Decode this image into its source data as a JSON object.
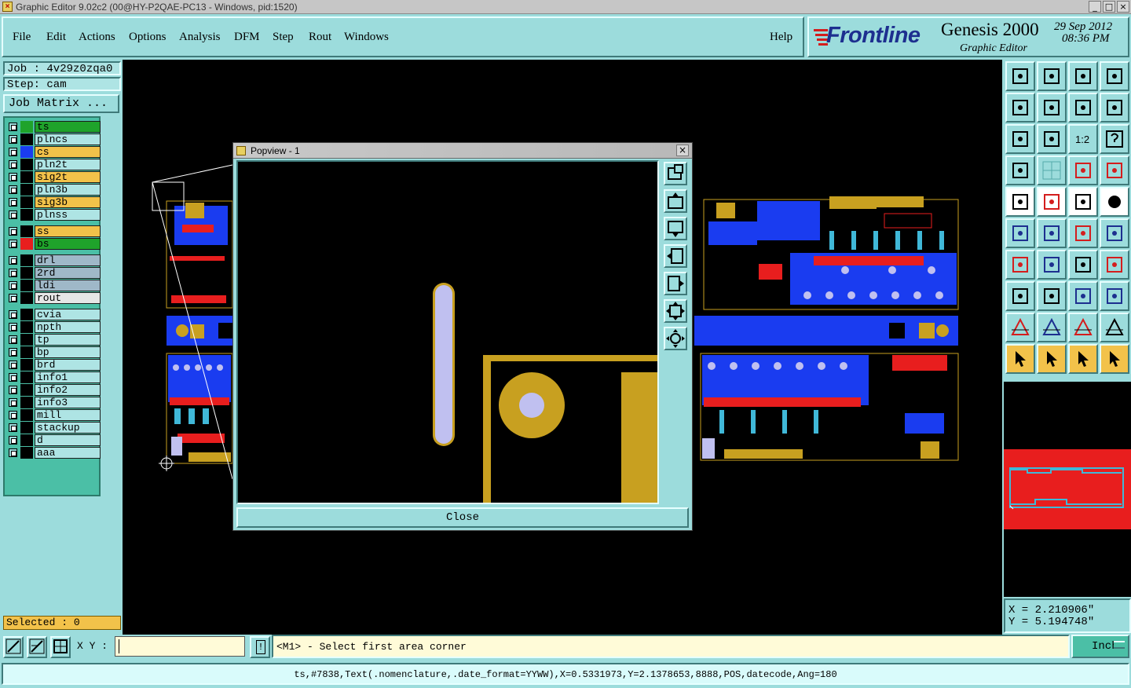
{
  "window": {
    "title": "Graphic Editor 9.02c2 (00@HY-P2QAE-PC13 - Windows, pid:1520)",
    "min_glyph": "_",
    "max_glyph": "□",
    "close_glyph": "×"
  },
  "menu": {
    "items": [
      "File",
      "Edit",
      "Actions",
      "Options",
      "Analysis",
      "DFM",
      "Step",
      "Rout",
      "Windows"
    ],
    "help": "Help"
  },
  "logo": {
    "brand": "Frontline",
    "product": "Genesis 2000",
    "subtitle": "Graphic Editor",
    "date": "29 Sep 2012",
    "time": "08:36 PM"
  },
  "job": {
    "job_label": "Job : 4v29z0zqa0",
    "step_label": "Step: cam",
    "matrix_button": "Job Matrix ..."
  },
  "layers": [
    {
      "name": "ts",
      "swatch": "#1fa32b",
      "bg": "#1fa32b"
    },
    {
      "name": "plncs",
      "swatch": "#000000",
      "bg": "#aee4e4"
    },
    {
      "name": "cs",
      "swatch": "#1a3cf0",
      "bg": "#f2c24a"
    },
    {
      "name": "pln2t",
      "swatch": "#000000",
      "bg": "#aee4e4"
    },
    {
      "name": "sig2t",
      "swatch": "#000000",
      "bg": "#f2c24a"
    },
    {
      "name": "pln3b",
      "swatch": "#000000",
      "bg": "#aee4e4"
    },
    {
      "name": "sig3b",
      "swatch": "#000000",
      "bg": "#f2c24a"
    },
    {
      "name": "plnss",
      "swatch": "#000000",
      "bg": "#aee4e4"
    },
    {
      "name": "ss",
      "swatch": "#000000",
      "bg": "#f2c24a"
    },
    {
      "name": "bs",
      "swatch": "#e81e1e",
      "bg": "#1fa32b"
    },
    {
      "name": "drl",
      "swatch": "#000000",
      "bg": "#9fb8c8"
    },
    {
      "name": "2rd",
      "swatch": "#000000",
      "bg": "#9fb8c8"
    },
    {
      "name": "ldi",
      "swatch": "#000000",
      "bg": "#9fb8c8"
    },
    {
      "name": "rout",
      "swatch": "#000000",
      "bg": "#e6e6e6"
    },
    {
      "name": "cvia",
      "swatch": "#000000",
      "bg": "#aee4e4"
    },
    {
      "name": "npth",
      "swatch": "#000000",
      "bg": "#aee4e4"
    },
    {
      "name": "tp",
      "swatch": "#000000",
      "bg": "#aee4e4"
    },
    {
      "name": "bp",
      "swatch": "#000000",
      "bg": "#aee4e4"
    },
    {
      "name": "brd",
      "swatch": "#000000",
      "bg": "#aee4e4"
    },
    {
      "name": "info1",
      "swatch": "#000000",
      "bg": "#aee4e4"
    },
    {
      "name": "info2",
      "swatch": "#000000",
      "bg": "#aee4e4"
    },
    {
      "name": "info3",
      "swatch": "#000000",
      "bg": "#aee4e4"
    },
    {
      "name": "mill",
      "swatch": "#000000",
      "bg": "#aee4e4"
    },
    {
      "name": "stackup",
      "swatch": "#000000",
      "bg": "#aee4e4"
    },
    {
      "name": "d",
      "swatch": "#000000",
      "bg": "#aee4e4"
    },
    {
      "name": "aaa",
      "swatch": "#000000",
      "bg": "#aee4e4"
    }
  ],
  "selection": {
    "text": "Selected : 0"
  },
  "popview": {
    "title": "Popview - 1",
    "close_glyph": "×",
    "close_button": "Close"
  },
  "coords": {
    "x": "X = 2.210906\"",
    "y": "Y = 5.194748\""
  },
  "input": {
    "xy_label": "X Y :",
    "prompt": "<M1> - Select first area corner",
    "units": "Inch",
    "excl_glyph": "!"
  },
  "status": {
    "line": "ts,#7838,Text(.nomenclature,.date_format=YYWW),X=0.5331973,Y=2.1378653,8888,POS,datecode,Ang=180"
  },
  "toolbar_tools": [
    "copy-to-layer-icon",
    "move-to-layer-icon",
    "home-icon",
    "split-view-icon",
    "pan-left-icon",
    "pan-right-icon",
    "undo-view-icon",
    "flip-view-icon",
    "zoom-fit-icon",
    "zoom-center-icon",
    "one-to-one-icon",
    "help-icon",
    "graphic-controls-icon",
    "grid-icon",
    "snap-red-icon",
    "snap-red-alt-icon",
    "add-feature-icon",
    "ruler-red-icon",
    "measure-icon",
    "circle-icon",
    "connect-icon",
    "intersect-icon",
    "line-red-icon",
    "line-alt-icon",
    "angle-red-icon",
    "slash-icon",
    "arc-icon",
    "pad-red-icon",
    "pad-arrow-icon",
    "line-dash-icon",
    "scale-icon",
    "copy-blob-icon",
    "triangle-red-icon",
    "triangle-blue-icon",
    "triangle-red-alt-icon",
    "triangle-tilt-icon",
    "pointer-icon",
    "pointer-select-icon",
    "pointer-alt-icon",
    "pointer-route-icon"
  ]
}
